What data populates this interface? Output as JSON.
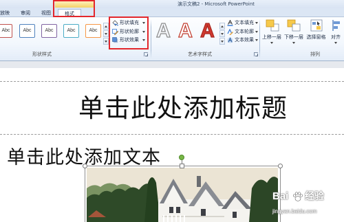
{
  "window": {
    "title": "演示文稿2 - Microsoft PowerPoint"
  },
  "tabs": [
    {
      "label": "放映"
    },
    {
      "label": "审阅"
    },
    {
      "label": "视图"
    },
    {
      "label": "格式",
      "active": true
    }
  ],
  "shape_styles": {
    "group_label": "形状样式",
    "presets": [
      {
        "label": "Abc",
        "color": "#c0504d"
      },
      {
        "label": "Abc",
        "color": "#4f81bd"
      },
      {
        "label": "Abc",
        "color": "#8064a2"
      },
      {
        "label": "Abc",
        "color": "#4bacc6"
      },
      {
        "label": "Abc",
        "color": "#f79646"
      }
    ],
    "commands": [
      {
        "label": "形状填充",
        "icon": "paint-bucket-icon"
      },
      {
        "label": "形状轮廓",
        "icon": "pen-outline-icon"
      },
      {
        "label": "形状效果",
        "icon": "shape-effects-icon"
      }
    ]
  },
  "wordart_styles": {
    "group_label": "艺术字样式",
    "presets": [
      {
        "label": "A",
        "fill": "#f4f6fa",
        "outline": "#8c8c8c"
      },
      {
        "label": "A",
        "fill": "#ffffff",
        "outline": "#c0392b"
      },
      {
        "label": "A",
        "fill": "#d0392f",
        "outline": "#a82820"
      }
    ],
    "commands": [
      {
        "label": "文本填充",
        "icon": "text-fill-icon"
      },
      {
        "label": "文本轮廓",
        "icon": "text-outline-icon"
      },
      {
        "label": "文本效果",
        "icon": "text-effects-icon"
      }
    ]
  },
  "arrange": {
    "group_label": "排列",
    "commands": [
      {
        "label": "上移一层",
        "icon": "bring-forward-icon"
      },
      {
        "label": "下移一层",
        "icon": "send-backward-icon"
      },
      {
        "label": "选择窗格",
        "icon": "selection-pane-icon"
      },
      {
        "label": "对齐",
        "icon": "align-icon"
      }
    ]
  },
  "slide": {
    "title_placeholder": "单击此处添加标题",
    "body_placeholder": "单击此处添加文本"
  },
  "watermark": {
    "brand": "Bai",
    "product": "经验",
    "url": "jingyan.baidu.com"
  },
  "colors": {
    "annotation_red": "#e3262b",
    "rotation_handle": "#77b646",
    "contextual_tab": "#f5d266",
    "ribbon_text": "#1f2d45"
  }
}
